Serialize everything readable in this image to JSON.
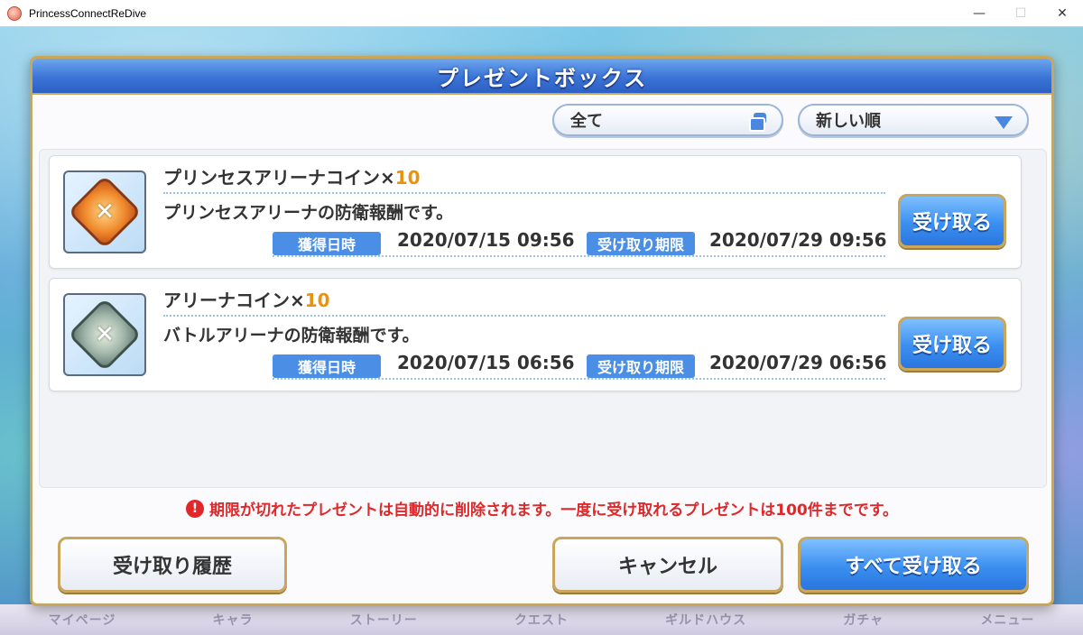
{
  "window": {
    "title": "PrincessConnectReDive",
    "minimize": "—",
    "maximize": "☐",
    "close": "✕"
  },
  "bottom_nav": [
    "マイページ",
    "キャラ",
    "ストーリー",
    "クエスト",
    "ギルドハウス",
    "ガチャ",
    "メニュー"
  ],
  "dialog": {
    "title": "プレゼントボックス",
    "filter_type": "全て",
    "sort_order": "新しい順",
    "items": [
      {
        "name": "プリンセスアリーナコイン×",
        "quantity": "10",
        "icon": "princess-arena-coin-icon",
        "description": "プリンセスアリーナの防衛報酬です。",
        "received_label": "獲得日時",
        "received_at": "2020/07/15 09:56",
        "expires_label": "受け取り期限",
        "expires_at": "2020/07/29 09:56",
        "button": "受け取る"
      },
      {
        "name": "アリーナコイン×",
        "quantity": "10",
        "icon": "arena-coin-icon",
        "description": "バトルアリーナの防衛報酬です。",
        "received_label": "獲得日時",
        "received_at": "2020/07/15 06:56",
        "expires_label": "受け取り期限",
        "expires_at": "2020/07/29 06:56",
        "button": "受け取る"
      }
    ],
    "notice": "期限が切れたプレゼントは自動的に削除されます。一度に受け取れるプレゼントは100件までです。",
    "buttons": {
      "history": "受け取り履歴",
      "cancel": "キャンセル",
      "receive_all": "すべて受け取る"
    }
  },
  "colors": {
    "header_blue": "#3b74d6",
    "accent_gold": "#c8a65a",
    "quantity_orange": "#e8920e",
    "notice_red": "#e0282a",
    "badge_blue": "#4a8ee6"
  }
}
